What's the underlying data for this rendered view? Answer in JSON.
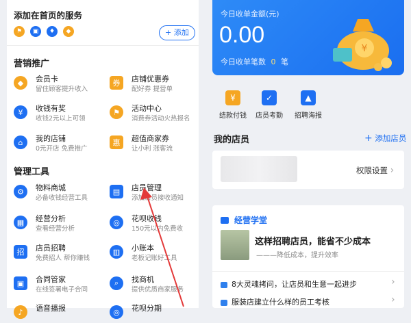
{
  "left": {
    "home_services": {
      "title": "添加在首页的服务",
      "add_label": "+ 添加"
    },
    "marketing": {
      "title": "营销推广",
      "items": [
        {
          "name": "会员卡",
          "desc": "留住顾客提升收入"
        },
        {
          "name": "店铺优惠券",
          "desc": "配好券 提营单"
        },
        {
          "name": "收钱有奖",
          "desc": "收钱2元以上可领"
        },
        {
          "name": "活动中心",
          "desc": "消费券活动火热报名"
        },
        {
          "name": "我的店铺",
          "desc": "0元开店 免费推广"
        },
        {
          "name": "超值商家券",
          "desc": "让小利 涨客流"
        }
      ]
    },
    "management": {
      "title": "管理工具",
      "items": [
        {
          "name": "物料商城",
          "desc": "必备收钱经营工具"
        },
        {
          "name": "店员管理",
          "desc": "添加店员接收通知"
        },
        {
          "name": "经营分析",
          "desc": "查看经营分析"
        },
        {
          "name": "花呗收钱",
          "desc": "150元以内免费收"
        },
        {
          "name": "店员招聘",
          "desc": "免费招人 帮你赚钱"
        },
        {
          "name": "小账本",
          "desc": "老板记账好工具"
        },
        {
          "name": "合同管家",
          "desc": "在线签署电子合同"
        },
        {
          "name": "找商机",
          "desc": "提供优质商家服务"
        },
        {
          "name": "语音播报",
          "desc": ""
        },
        {
          "name": "花呗分期",
          "desc": ""
        }
      ]
    }
  },
  "right": {
    "today": {
      "label": "今日收单金额(元)",
      "amount": "0.00",
      "count_label": "今日收单笔数",
      "count": "0",
      "count_unit": "笔",
      "coin_symbol": "¥"
    },
    "quick_actions": [
      "结款付钱",
      "店员考勤",
      "招聘海报"
    ],
    "staff": {
      "title": "我的店员",
      "add_label": "添加店员",
      "permission_label": "权限设置"
    },
    "academy": {
      "title": "经营学堂",
      "headline": "这样招聘店员，能省不少成本",
      "subline": "———降低成本，提升效率",
      "news": [
        "8大灵魂拷问，让店员和生意一起进步",
        "服装店建立什么样的员工考核"
      ]
    }
  },
  "colors": {
    "brand_blue": "#1e6ff2",
    "accent_red": "#e33a3a",
    "orange": "#f5a623"
  }
}
